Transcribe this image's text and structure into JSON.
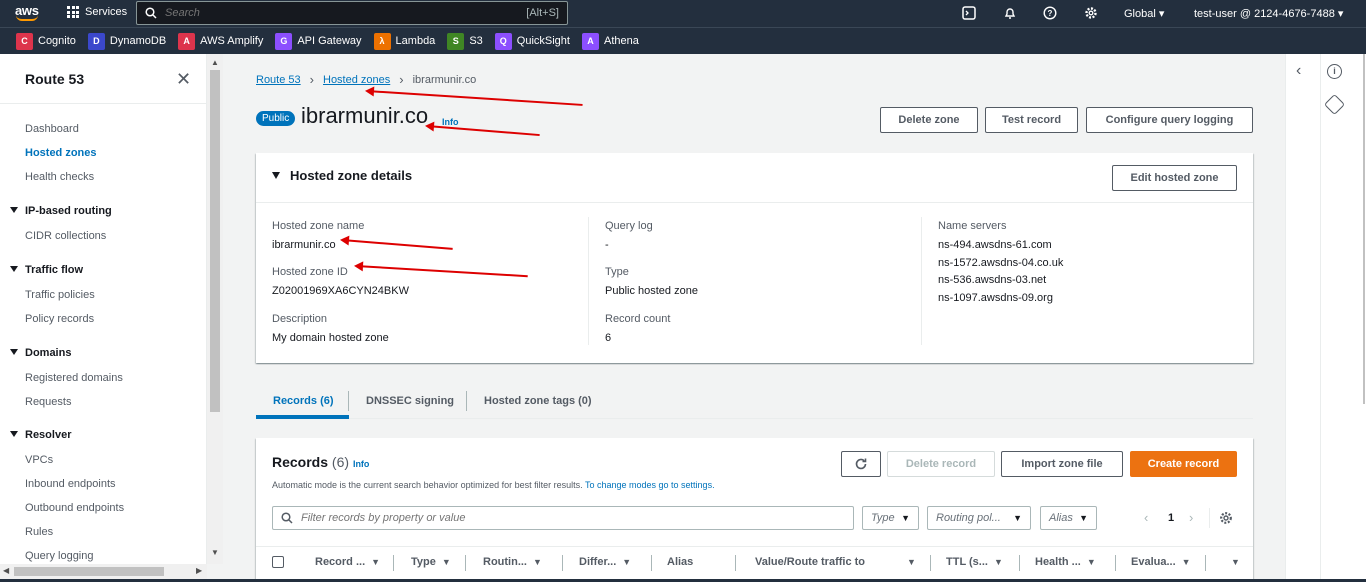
{
  "topnav": {
    "logo": "aws",
    "services_label": "Services",
    "search_placeholder": "Search",
    "search_shortcut": "[Alt+S]",
    "region": "Global",
    "account": "test-user @ 2124-4676-7488"
  },
  "favorites": [
    {
      "label": "Cognito",
      "icon": "cognito-icon",
      "color": "#dd344c",
      "glyph": "C"
    },
    {
      "label": "DynamoDB",
      "icon": "dynamodb-icon",
      "color": "#3b48cc",
      "glyph": "D"
    },
    {
      "label": "AWS Amplify",
      "icon": "amplify-icon",
      "color": "#dd344c",
      "glyph": "A"
    },
    {
      "label": "API Gateway",
      "icon": "api-gateway-icon",
      "color": "#8c4fff",
      "glyph": "G"
    },
    {
      "label": "Lambda",
      "icon": "lambda-icon",
      "color": "#ed7100",
      "glyph": "λ"
    },
    {
      "label": "S3",
      "icon": "s3-icon",
      "color": "#3f8624",
      "glyph": "S"
    },
    {
      "label": "QuickSight",
      "icon": "quicksight-icon",
      "color": "#8c4fff",
      "glyph": "Q"
    },
    {
      "label": "Athena",
      "icon": "athena-icon",
      "color": "#8c4fff",
      "glyph": "A"
    }
  ],
  "sidebar": {
    "title": "Route 53",
    "items": [
      "Dashboard",
      "Hosted zones",
      "Health checks"
    ],
    "sections": [
      {
        "title": "IP-based routing",
        "items": [
          "CIDR collections"
        ]
      },
      {
        "title": "Traffic flow",
        "items": [
          "Traffic policies",
          "Policy records"
        ]
      },
      {
        "title": "Domains",
        "items": [
          "Registered domains",
          "Requests"
        ]
      },
      {
        "title": "Resolver",
        "items": [
          "VPCs",
          "Inbound endpoints",
          "Outbound endpoints",
          "Rules",
          "Query logging"
        ]
      }
    ]
  },
  "breadcrumb": {
    "root": "Route 53",
    "parent": "Hosted zones",
    "current": "ibrarmunir.co"
  },
  "header": {
    "badge": "Public",
    "title": "ibrarmunir.co",
    "info": "Info",
    "buttons": [
      "Delete zone",
      "Test record",
      "Configure query logging"
    ]
  },
  "details": {
    "title": "Hosted zone details",
    "edit_button": "Edit hosted zone",
    "zone_name_label": "Hosted zone name",
    "zone_name": "ibrarmunir.co",
    "zone_id_label": "Hosted zone ID",
    "zone_id": "Z02001969XA6CYN24BKW",
    "description_label": "Description",
    "description": "My domain hosted zone",
    "query_log_label": "Query log",
    "query_log": "-",
    "type_label": "Type",
    "type": "Public hosted zone",
    "record_count_label": "Record count",
    "record_count": "6",
    "name_servers_label": "Name servers",
    "name_servers": [
      "ns-494.awsdns-61.com",
      "ns-1572.awsdns-04.co.uk",
      "ns-536.awsdns-03.net",
      "ns-1097.awsdns-09.org"
    ]
  },
  "tabs": [
    "Records (6)",
    "DNSSEC signing",
    "Hosted zone tags (0)"
  ],
  "records": {
    "title": "Records",
    "count": "(6)",
    "info": "Info",
    "description": "Automatic mode is the current search behavior optimized for best filter results.",
    "description_link": "To change modes go to settings.",
    "buttons": {
      "delete": "Delete record",
      "import": "Import zone file",
      "create": "Create record"
    },
    "filter_placeholder": "Filter records by property or value",
    "selects": [
      "Type",
      "Routing pol...",
      "Alias"
    ],
    "page": "1",
    "columns": [
      "Record ...",
      "Type",
      "Routin...",
      "Differ...",
      "Alias",
      "Value/Route traffic to",
      "TTL (s...",
      "Health ...",
      "Evalua..."
    ]
  },
  "colors": {
    "accent": "#0073bb",
    "primary_button": "#ec7211",
    "nav": "#232f3e",
    "annotation": "#dd0000"
  }
}
